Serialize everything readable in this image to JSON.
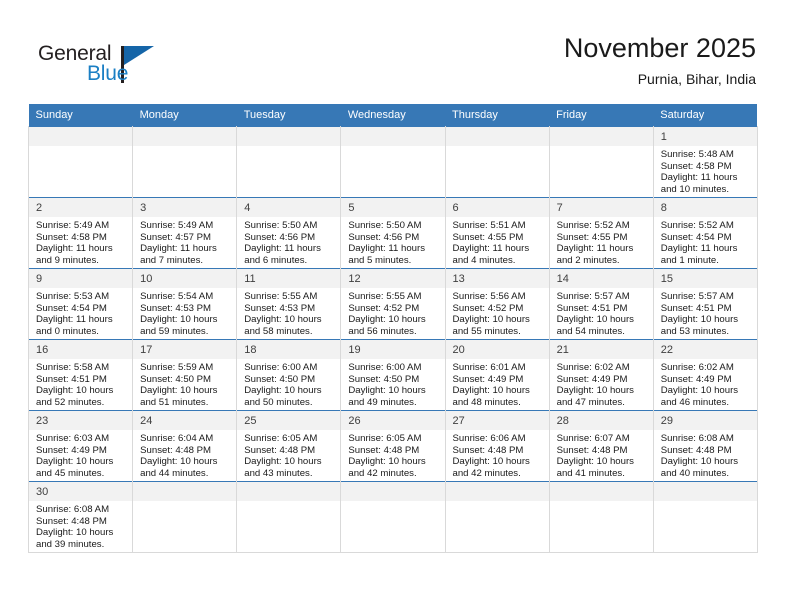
{
  "brand": {
    "name_top": "General",
    "name_bottom": "Blue",
    "accent_color": "#1b7fc4",
    "flag_color": "#1565a8"
  },
  "header": {
    "title": "November 2025",
    "subtitle": "Purnia, Bihar, India"
  },
  "theme": {
    "header_row_bg": "#3778b6",
    "daynum_bg": "#f2f2f2",
    "grid_line": "#d9d9d9",
    "text": "#1a1a1a"
  },
  "weekdays": [
    "Sunday",
    "Monday",
    "Tuesday",
    "Wednesday",
    "Thursday",
    "Friday",
    "Saturday"
  ],
  "labels": {
    "sunrise": "Sunrise:",
    "sunset": "Sunset:",
    "daylight": "Daylight:"
  },
  "weeks": [
    [
      {
        "day": "",
        "sunrise": "",
        "sunset": "",
        "daylight": "",
        "empty": true
      },
      {
        "day": "",
        "sunrise": "",
        "sunset": "",
        "daylight": "",
        "empty": true
      },
      {
        "day": "",
        "sunrise": "",
        "sunset": "",
        "daylight": "",
        "empty": true
      },
      {
        "day": "",
        "sunrise": "",
        "sunset": "",
        "daylight": "",
        "empty": true
      },
      {
        "day": "",
        "sunrise": "",
        "sunset": "",
        "daylight": "",
        "empty": true
      },
      {
        "day": "",
        "sunrise": "",
        "sunset": "",
        "daylight": "",
        "empty": true
      },
      {
        "day": "1",
        "sunrise": "Sunrise: 5:48 AM",
        "sunset": "Sunset: 4:58 PM",
        "daylight": "Daylight: 11 hours and 10 minutes."
      }
    ],
    [
      {
        "day": "2",
        "sunrise": "Sunrise: 5:49 AM",
        "sunset": "Sunset: 4:58 PM",
        "daylight": "Daylight: 11 hours and 9 minutes."
      },
      {
        "day": "3",
        "sunrise": "Sunrise: 5:49 AM",
        "sunset": "Sunset: 4:57 PM",
        "daylight": "Daylight: 11 hours and 7 minutes."
      },
      {
        "day": "4",
        "sunrise": "Sunrise: 5:50 AM",
        "sunset": "Sunset: 4:56 PM",
        "daylight": "Daylight: 11 hours and 6 minutes."
      },
      {
        "day": "5",
        "sunrise": "Sunrise: 5:50 AM",
        "sunset": "Sunset: 4:56 PM",
        "daylight": "Daylight: 11 hours and 5 minutes."
      },
      {
        "day": "6",
        "sunrise": "Sunrise: 5:51 AM",
        "sunset": "Sunset: 4:55 PM",
        "daylight": "Daylight: 11 hours and 4 minutes."
      },
      {
        "day": "7",
        "sunrise": "Sunrise: 5:52 AM",
        "sunset": "Sunset: 4:55 PM",
        "daylight": "Daylight: 11 hours and 2 minutes."
      },
      {
        "day": "8",
        "sunrise": "Sunrise: 5:52 AM",
        "sunset": "Sunset: 4:54 PM",
        "daylight": "Daylight: 11 hours and 1 minute."
      }
    ],
    [
      {
        "day": "9",
        "sunrise": "Sunrise: 5:53 AM",
        "sunset": "Sunset: 4:54 PM",
        "daylight": "Daylight: 11 hours and 0 minutes."
      },
      {
        "day": "10",
        "sunrise": "Sunrise: 5:54 AM",
        "sunset": "Sunset: 4:53 PM",
        "daylight": "Daylight: 10 hours and 59 minutes."
      },
      {
        "day": "11",
        "sunrise": "Sunrise: 5:55 AM",
        "sunset": "Sunset: 4:53 PM",
        "daylight": "Daylight: 10 hours and 58 minutes."
      },
      {
        "day": "12",
        "sunrise": "Sunrise: 5:55 AM",
        "sunset": "Sunset: 4:52 PM",
        "daylight": "Daylight: 10 hours and 56 minutes."
      },
      {
        "day": "13",
        "sunrise": "Sunrise: 5:56 AM",
        "sunset": "Sunset: 4:52 PM",
        "daylight": "Daylight: 10 hours and 55 minutes."
      },
      {
        "day": "14",
        "sunrise": "Sunrise: 5:57 AM",
        "sunset": "Sunset: 4:51 PM",
        "daylight": "Daylight: 10 hours and 54 minutes."
      },
      {
        "day": "15",
        "sunrise": "Sunrise: 5:57 AM",
        "sunset": "Sunset: 4:51 PM",
        "daylight": "Daylight: 10 hours and 53 minutes."
      }
    ],
    [
      {
        "day": "16",
        "sunrise": "Sunrise: 5:58 AM",
        "sunset": "Sunset: 4:51 PM",
        "daylight": "Daylight: 10 hours and 52 minutes."
      },
      {
        "day": "17",
        "sunrise": "Sunrise: 5:59 AM",
        "sunset": "Sunset: 4:50 PM",
        "daylight": "Daylight: 10 hours and 51 minutes."
      },
      {
        "day": "18",
        "sunrise": "Sunrise: 6:00 AM",
        "sunset": "Sunset: 4:50 PM",
        "daylight": "Daylight: 10 hours and 50 minutes."
      },
      {
        "day": "19",
        "sunrise": "Sunrise: 6:00 AM",
        "sunset": "Sunset: 4:50 PM",
        "daylight": "Daylight: 10 hours and 49 minutes."
      },
      {
        "day": "20",
        "sunrise": "Sunrise: 6:01 AM",
        "sunset": "Sunset: 4:49 PM",
        "daylight": "Daylight: 10 hours and 48 minutes."
      },
      {
        "day": "21",
        "sunrise": "Sunrise: 6:02 AM",
        "sunset": "Sunset: 4:49 PM",
        "daylight": "Daylight: 10 hours and 47 minutes."
      },
      {
        "day": "22",
        "sunrise": "Sunrise: 6:02 AM",
        "sunset": "Sunset: 4:49 PM",
        "daylight": "Daylight: 10 hours and 46 minutes."
      }
    ],
    [
      {
        "day": "23",
        "sunrise": "Sunrise: 6:03 AM",
        "sunset": "Sunset: 4:49 PM",
        "daylight": "Daylight: 10 hours and 45 minutes."
      },
      {
        "day": "24",
        "sunrise": "Sunrise: 6:04 AM",
        "sunset": "Sunset: 4:48 PM",
        "daylight": "Daylight: 10 hours and 44 minutes."
      },
      {
        "day": "25",
        "sunrise": "Sunrise: 6:05 AM",
        "sunset": "Sunset: 4:48 PM",
        "daylight": "Daylight: 10 hours and 43 minutes."
      },
      {
        "day": "26",
        "sunrise": "Sunrise: 6:05 AM",
        "sunset": "Sunset: 4:48 PM",
        "daylight": "Daylight: 10 hours and 42 minutes."
      },
      {
        "day": "27",
        "sunrise": "Sunrise: 6:06 AM",
        "sunset": "Sunset: 4:48 PM",
        "daylight": "Daylight: 10 hours and 42 minutes."
      },
      {
        "day": "28",
        "sunrise": "Sunrise: 6:07 AM",
        "sunset": "Sunset: 4:48 PM",
        "daylight": "Daylight: 10 hours and 41 minutes."
      },
      {
        "day": "29",
        "sunrise": "Sunrise: 6:08 AM",
        "sunset": "Sunset: 4:48 PM",
        "daylight": "Daylight: 10 hours and 40 minutes."
      }
    ],
    [
      {
        "day": "30",
        "sunrise": "Sunrise: 6:08 AM",
        "sunset": "Sunset: 4:48 PM",
        "daylight": "Daylight: 10 hours and 39 minutes."
      },
      {
        "day": "",
        "sunrise": "",
        "sunset": "",
        "daylight": "",
        "empty": true
      },
      {
        "day": "",
        "sunrise": "",
        "sunset": "",
        "daylight": "",
        "empty": true
      },
      {
        "day": "",
        "sunrise": "",
        "sunset": "",
        "daylight": "",
        "empty": true
      },
      {
        "day": "",
        "sunrise": "",
        "sunset": "",
        "daylight": "",
        "empty": true
      },
      {
        "day": "",
        "sunrise": "",
        "sunset": "",
        "daylight": "",
        "empty": true
      },
      {
        "day": "",
        "sunrise": "",
        "sunset": "",
        "daylight": "",
        "empty": true
      }
    ]
  ]
}
